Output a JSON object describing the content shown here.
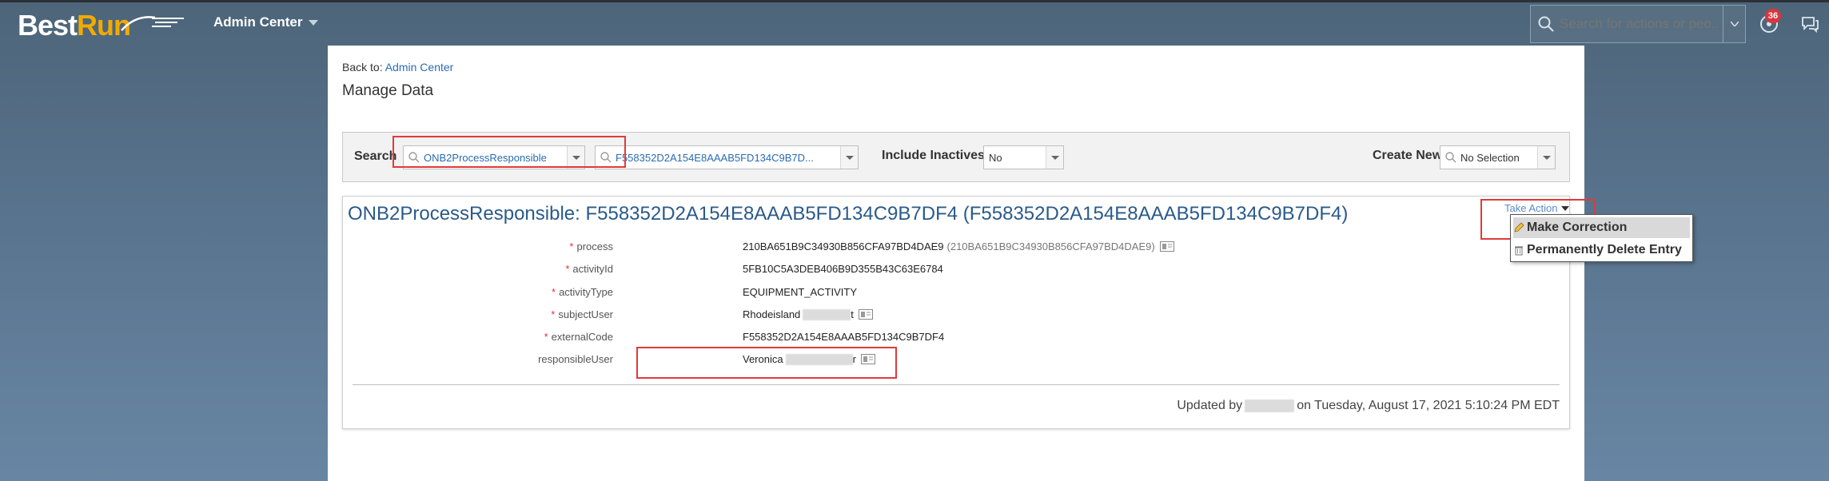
{
  "header": {
    "logo_best": "Best",
    "logo_run": "Run",
    "module": "Admin Center",
    "search_placeholder": "Search for actions or peo...",
    "notification_count": "36"
  },
  "page": {
    "back_prefix": "Back to:",
    "back_link": "Admin Center",
    "title": "Manage Data"
  },
  "search": {
    "label": "Search",
    "object_type": "ONB2ProcessResponsible",
    "object_id": "F558352D2A154E8AAAB5FD134C9B7D...",
    "include_inactives_label": "Include Inactives:",
    "include_inactives_value": "No",
    "create_new_label": "Create New",
    "create_new_value": "No Selection"
  },
  "record": {
    "title": "ONB2ProcessResponsible: F558352D2A154E8AAAB5FD134C9B7DF4 (F558352D2A154E8AAAB5FD134C9B7DF4)",
    "take_action": "Take Action",
    "menu": {
      "make_correction": "Make Correction",
      "delete": "Permanently Delete Entry"
    },
    "fields": [
      {
        "label": "process",
        "required": "*",
        "value": "210BA651B9C34930B856CFA97BD4DAE9",
        "extra": "(210BA651B9C34930B856CFA97BD4DAE9)"
      },
      {
        "label": "activityId",
        "required": "*",
        "value": "5FB10C5A3DEB406B9D355B43C63E6784"
      },
      {
        "label": "activityType",
        "required": "*",
        "value": "EQUIPMENT_ACTIVITY"
      },
      {
        "label": "subjectUser",
        "required": "*",
        "value": "Rhodeisland",
        "suffix": "t"
      },
      {
        "label": "externalCode",
        "required": "*",
        "value": "F558352D2A154E8AAAB5FD134C9B7DF4"
      },
      {
        "label": "responsibleUser",
        "required": "",
        "value": "Veronica",
        "suffix": "r"
      }
    ],
    "updated_prefix": "Updated by",
    "updated_suffix": "on Tuesday, August 17, 2021 5:10:24 PM EDT"
  },
  "colors": {
    "accent_link": "#2a6cb0",
    "highlight_box": "#e03a3a",
    "required": "#d9363e",
    "brand_orange": "#f0ab00"
  }
}
